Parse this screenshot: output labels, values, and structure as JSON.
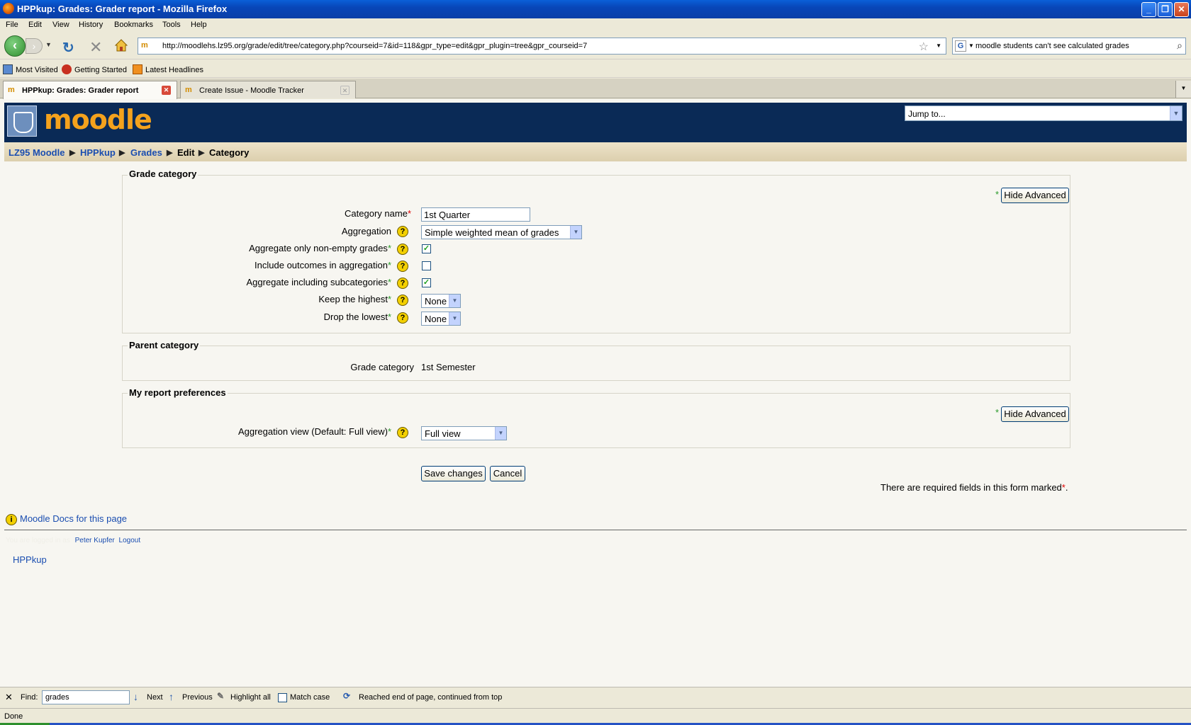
{
  "window": {
    "title": "HPPkup: Grades: Grader report - Mozilla Firefox",
    "minimize": "_",
    "restore": "❐",
    "close": "✕"
  },
  "menu": [
    "File",
    "Edit",
    "View",
    "History",
    "Bookmarks",
    "Tools",
    "Help"
  ],
  "nav": {
    "url": "http://moodlehs.lz95.org/grade/edit/tree/category.php?courseid=7&id=118&gpr_type=edit&gpr_plugin=tree&gpr_courseid=7",
    "search_value": "moodle students can't see calculated grades",
    "search_engine": "G",
    "site_icon": "m"
  },
  "bookmarks": [
    "Most Visited",
    "Getting Started",
    "Latest Headlines"
  ],
  "tabs": [
    {
      "label": "HPPkup: Grades: Grader report",
      "active": true
    },
    {
      "label": "Create Issue - Moodle Tracker",
      "active": false
    }
  ],
  "page": {
    "logo": "moodle",
    "jump_to": "Jump to...",
    "breadcrumb": {
      "items": [
        "LZ95 Moodle",
        "HPPkup",
        "Grades"
      ],
      "plain": [
        "Edit",
        "Category"
      ],
      "sep": "▶"
    },
    "grade_category": {
      "legend": "Grade category",
      "hide_advanced": "Hide Advanced",
      "category_name_label": "Category name",
      "category_name_value": "1st Quarter",
      "aggregation_label": "Aggregation",
      "aggregation_value": "Simple weighted mean of grades",
      "nonempty_label": "Aggregate only non-empty grades",
      "outcomes_label": "Include outcomes in aggregation",
      "subcats_label": "Aggregate including subcategories",
      "keep_highest_label": "Keep the highest",
      "keep_highest_value": "None",
      "drop_lowest_label": "Drop the lowest",
      "drop_lowest_value": "None",
      "nonempty_checked": true,
      "outcomes_checked": false,
      "subcats_checked": true
    },
    "parent_category": {
      "legend": "Parent category",
      "label": "Grade category",
      "value": "1st Semester"
    },
    "report_prefs": {
      "legend": "My report preferences",
      "hide_advanced": "Hide Advanced",
      "agg_view_label": "Aggregation view (Default: Full view)",
      "agg_view_value": "Full view"
    },
    "save": "Save changes",
    "cancel": "Cancel",
    "required_note": "There are required fields in this form marked",
    "asterisk": "*",
    "help_glyph": "?",
    "docs_link": "Moodle Docs for this page",
    "logged_in_prefix": "You are logged in as",
    "user": "Peter Kupfer",
    "logout": "Logout",
    "course": "HPPkup"
  },
  "find": {
    "close": "✕",
    "label": "Find:",
    "value": "grades",
    "next": "Next",
    "previous": "Previous",
    "highlight": "Highlight all",
    "match_case": "Match case",
    "message": "Reached end of page, continued from top"
  },
  "status": "Done"
}
